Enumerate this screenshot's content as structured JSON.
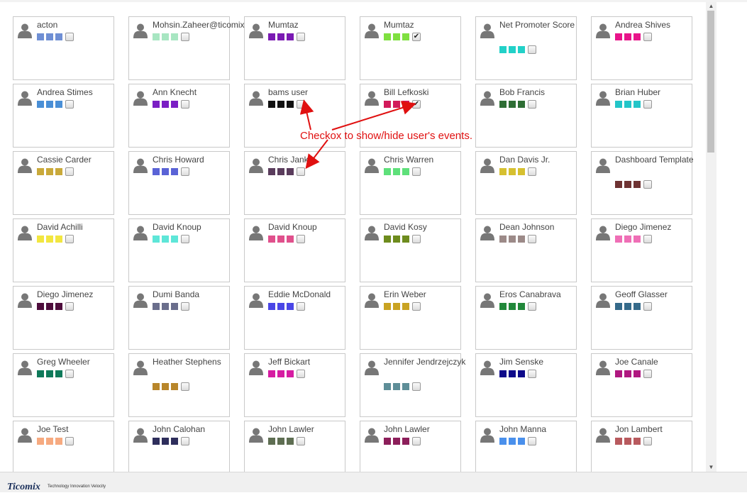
{
  "annotation": {
    "text": "Checkox to show/hide user's events."
  },
  "footer": {
    "logo": "Ticomix",
    "tagline": "Technology Innovation Velocity"
  },
  "users": [
    {
      "name": "acton",
      "color": "#6f8fd4",
      "checked": false
    },
    {
      "name": "Mohsin.Zaheer@ticomix.com",
      "color": "#a8e6c2",
      "checked": false
    },
    {
      "name": "Mumtaz",
      "color": "#7a1ab3",
      "checked": false
    },
    {
      "name": "Mumtaz",
      "color": "#7fe040",
      "checked": true
    },
    {
      "name": "Net Promoter Score",
      "color": "#22d1c8",
      "checked": false
    },
    {
      "name": "Andrea Shives",
      "color": "#e8148a",
      "checked": false
    },
    {
      "name": "Andrea Stimes",
      "color": "#4a8fd6",
      "checked": false
    },
    {
      "name": "Ann Knecht",
      "color": "#7b1fc4",
      "checked": false
    },
    {
      "name": "bams user",
      "color": "#111111",
      "checked": false
    },
    {
      "name": "Bill Lefkoski",
      "color": "#d21a5a",
      "checked": true
    },
    {
      "name": "Bob Francis",
      "color": "#2e6e34",
      "checked": false
    },
    {
      "name": "Brian Huber",
      "color": "#23c5c8",
      "checked": false
    },
    {
      "name": "Cassie Carder",
      "color": "#c9a93a",
      "checked": false
    },
    {
      "name": "Chris Howard",
      "color": "#5a63d6",
      "checked": false
    },
    {
      "name": "Chris Janke",
      "color": "#5a3c5c",
      "checked": false
    },
    {
      "name": "Chris Warren",
      "color": "#5ee07a",
      "checked": false
    },
    {
      "name": "Dan Davis Jr.",
      "color": "#d6c030",
      "checked": false
    },
    {
      "name": "Dashboard Template",
      "color": "#6e3232",
      "checked": false
    },
    {
      "name": "David Achilli",
      "color": "#f2e640",
      "checked": false
    },
    {
      "name": "David Knoup",
      "color": "#5ee6d8",
      "checked": false
    },
    {
      "name": "David Knoup",
      "color": "#e0508c",
      "checked": false
    },
    {
      "name": "David Kosy",
      "color": "#6e8c1e",
      "checked": false
    },
    {
      "name": "Dean Johnson",
      "color": "#9c8a88",
      "checked": false
    },
    {
      "name": "Diego Jimenez",
      "color": "#ef6fb6",
      "checked": false
    },
    {
      "name": "Diego Jimenez",
      "color": "#4e0d3c",
      "checked": false
    },
    {
      "name": "Dumi Banda",
      "color": "#6a6e8c",
      "checked": false
    },
    {
      "name": "Eddie McDonald",
      "color": "#4a46e6",
      "checked": false
    },
    {
      "name": "Erin Weber",
      "color": "#c9a322",
      "checked": false
    },
    {
      "name": "Eros Canabrava",
      "color": "#21883a",
      "checked": false
    },
    {
      "name": "Geoff Glasser",
      "color": "#356a8a",
      "checked": false
    },
    {
      "name": "Greg Wheeler",
      "color": "#0f7a5a",
      "checked": false
    },
    {
      "name": "Heather Stephens",
      "color": "#b8862a",
      "checked": false
    },
    {
      "name": "Jeff Bickart",
      "color": "#d61ca2",
      "checked": false
    },
    {
      "name": "Jennifer Jendrzejczyk",
      "color": "#5e8e98",
      "checked": false
    },
    {
      "name": "Jim Senske",
      "color": "#0e0a8a",
      "checked": false
    },
    {
      "name": "Joe Canale",
      "color": "#b01880",
      "checked": false
    },
    {
      "name": "Joe Test",
      "color": "#f6aa80",
      "checked": false
    },
    {
      "name": "John Calohan",
      "color": "#2e2e5c",
      "checked": false
    },
    {
      "name": "John Lawler",
      "color": "#5e6e52",
      "checked": false
    },
    {
      "name": "John Lawler",
      "color": "#8c1e5a",
      "checked": false
    },
    {
      "name": "John Manna",
      "color": "#4a90ec",
      "checked": false
    },
    {
      "name": "Jon Lambert",
      "color": "#b85a5e",
      "checked": false
    }
  ]
}
